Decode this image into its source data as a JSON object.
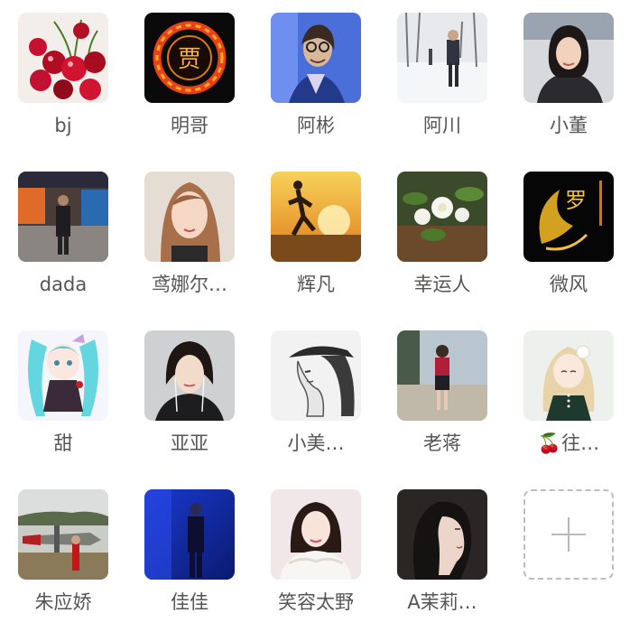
{
  "members": [
    {
      "name": "bj",
      "icon": "cherries-photo"
    },
    {
      "name": "明哥",
      "icon": "fire-ring-jia-logo"
    },
    {
      "name": "阿彬",
      "icon": "man-with-glasses-photo"
    },
    {
      "name": "阿川",
      "icon": "man-in-snow-photo"
    },
    {
      "name": "小董",
      "icon": "woman-portrait-photo"
    },
    {
      "name": "dada",
      "icon": "mall-interior-photo"
    },
    {
      "name": "鸢娜尔…",
      "icon": "woman-selfie-photo"
    },
    {
      "name": "辉凡",
      "icon": "runner-sunset-photo"
    },
    {
      "name": "幸运人",
      "icon": "gardenia-flowers-photo"
    },
    {
      "name": "微风",
      "icon": "golden-phoenix-luo-logo"
    },
    {
      "name": "甜",
      "icon": "anime-girl-photo"
    },
    {
      "name": "亚亚",
      "icon": "woman-earphones-photo"
    },
    {
      "name": "小美…",
      "icon": "woman-cap-sketch-photo"
    },
    {
      "name": "老蒋",
      "icon": "woman-street-photo"
    },
    {
      "name": "🍒往…",
      "icon": "cartoon-girl-photo"
    },
    {
      "name": "朱应娇",
      "icon": "airplane-person-photo"
    },
    {
      "name": "佳佳",
      "icon": "blue-scene-photo"
    },
    {
      "name": "笑容太野",
      "icon": "woman-fur-collar-photo"
    },
    {
      "name": "A茉莉…",
      "icon": "woman-profile-photo"
    }
  ],
  "add_member": {
    "icon": "plus-icon"
  },
  "colors": {
    "name_text": "#555555",
    "dashed_border": "#bdbdbd",
    "plus": "#b9b9b9"
  }
}
